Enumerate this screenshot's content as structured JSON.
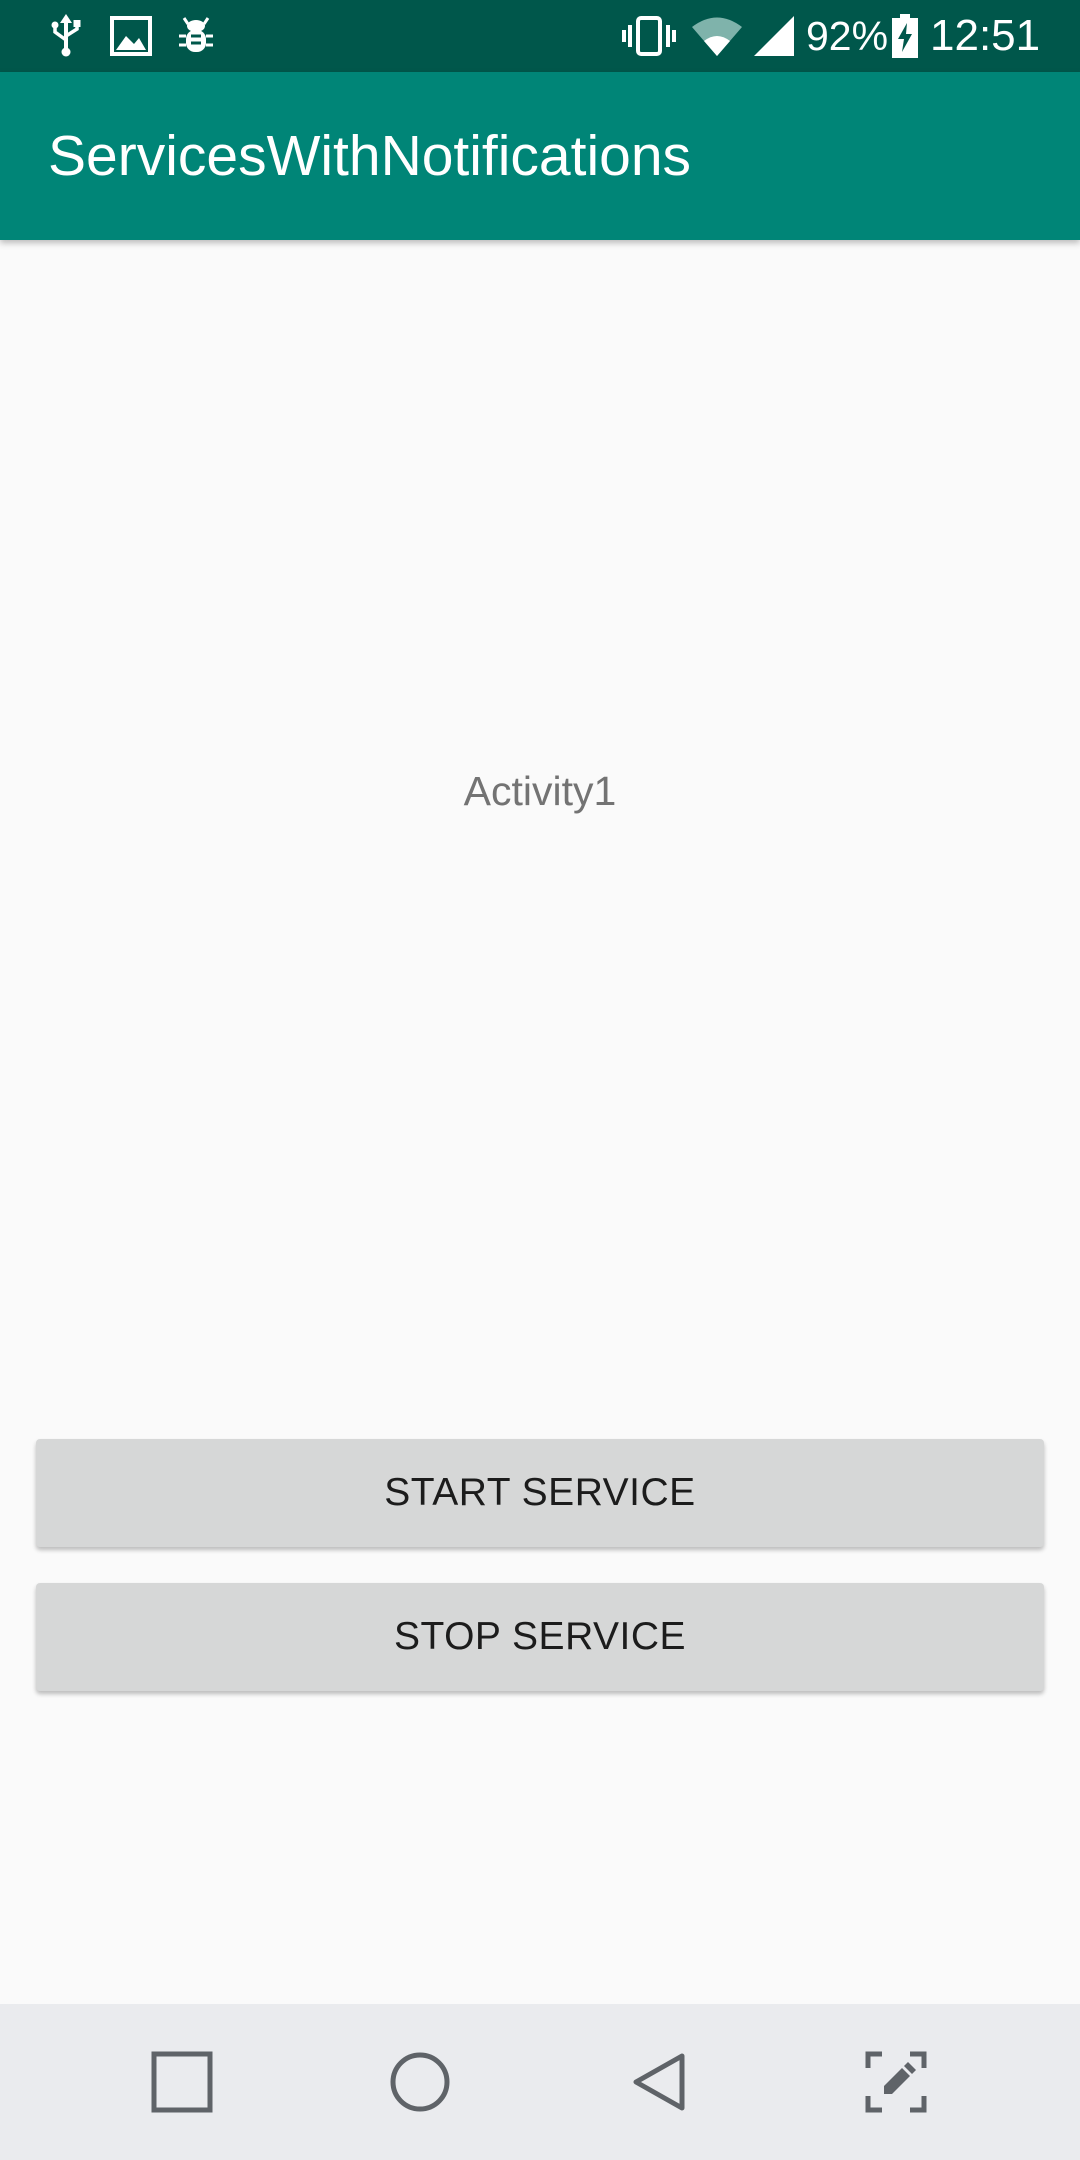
{
  "status_bar": {
    "left_icons": [
      "usb-icon",
      "image-icon",
      "bug-icon"
    ],
    "right_icons": [
      "vibrate-icon",
      "wifi-icon",
      "signal-icon",
      "battery-charging-icon"
    ],
    "battery_percent": "92%",
    "time": "12:51"
  },
  "app_bar": {
    "title": "ServicesWithNotifications"
  },
  "main": {
    "center_text": "Activity1",
    "start_button_label": "START SERVICE",
    "stop_button_label": "STOP SERVICE"
  },
  "nav_bar": {
    "items": [
      "recents-icon",
      "home-icon",
      "back-icon",
      "screenshot-edit-icon"
    ]
  },
  "colors": {
    "status_bar": "#00574b",
    "app_bar": "#008577",
    "background": "#fafafa",
    "button": "#d6d7d7",
    "nav_bar": "#eaebee"
  }
}
